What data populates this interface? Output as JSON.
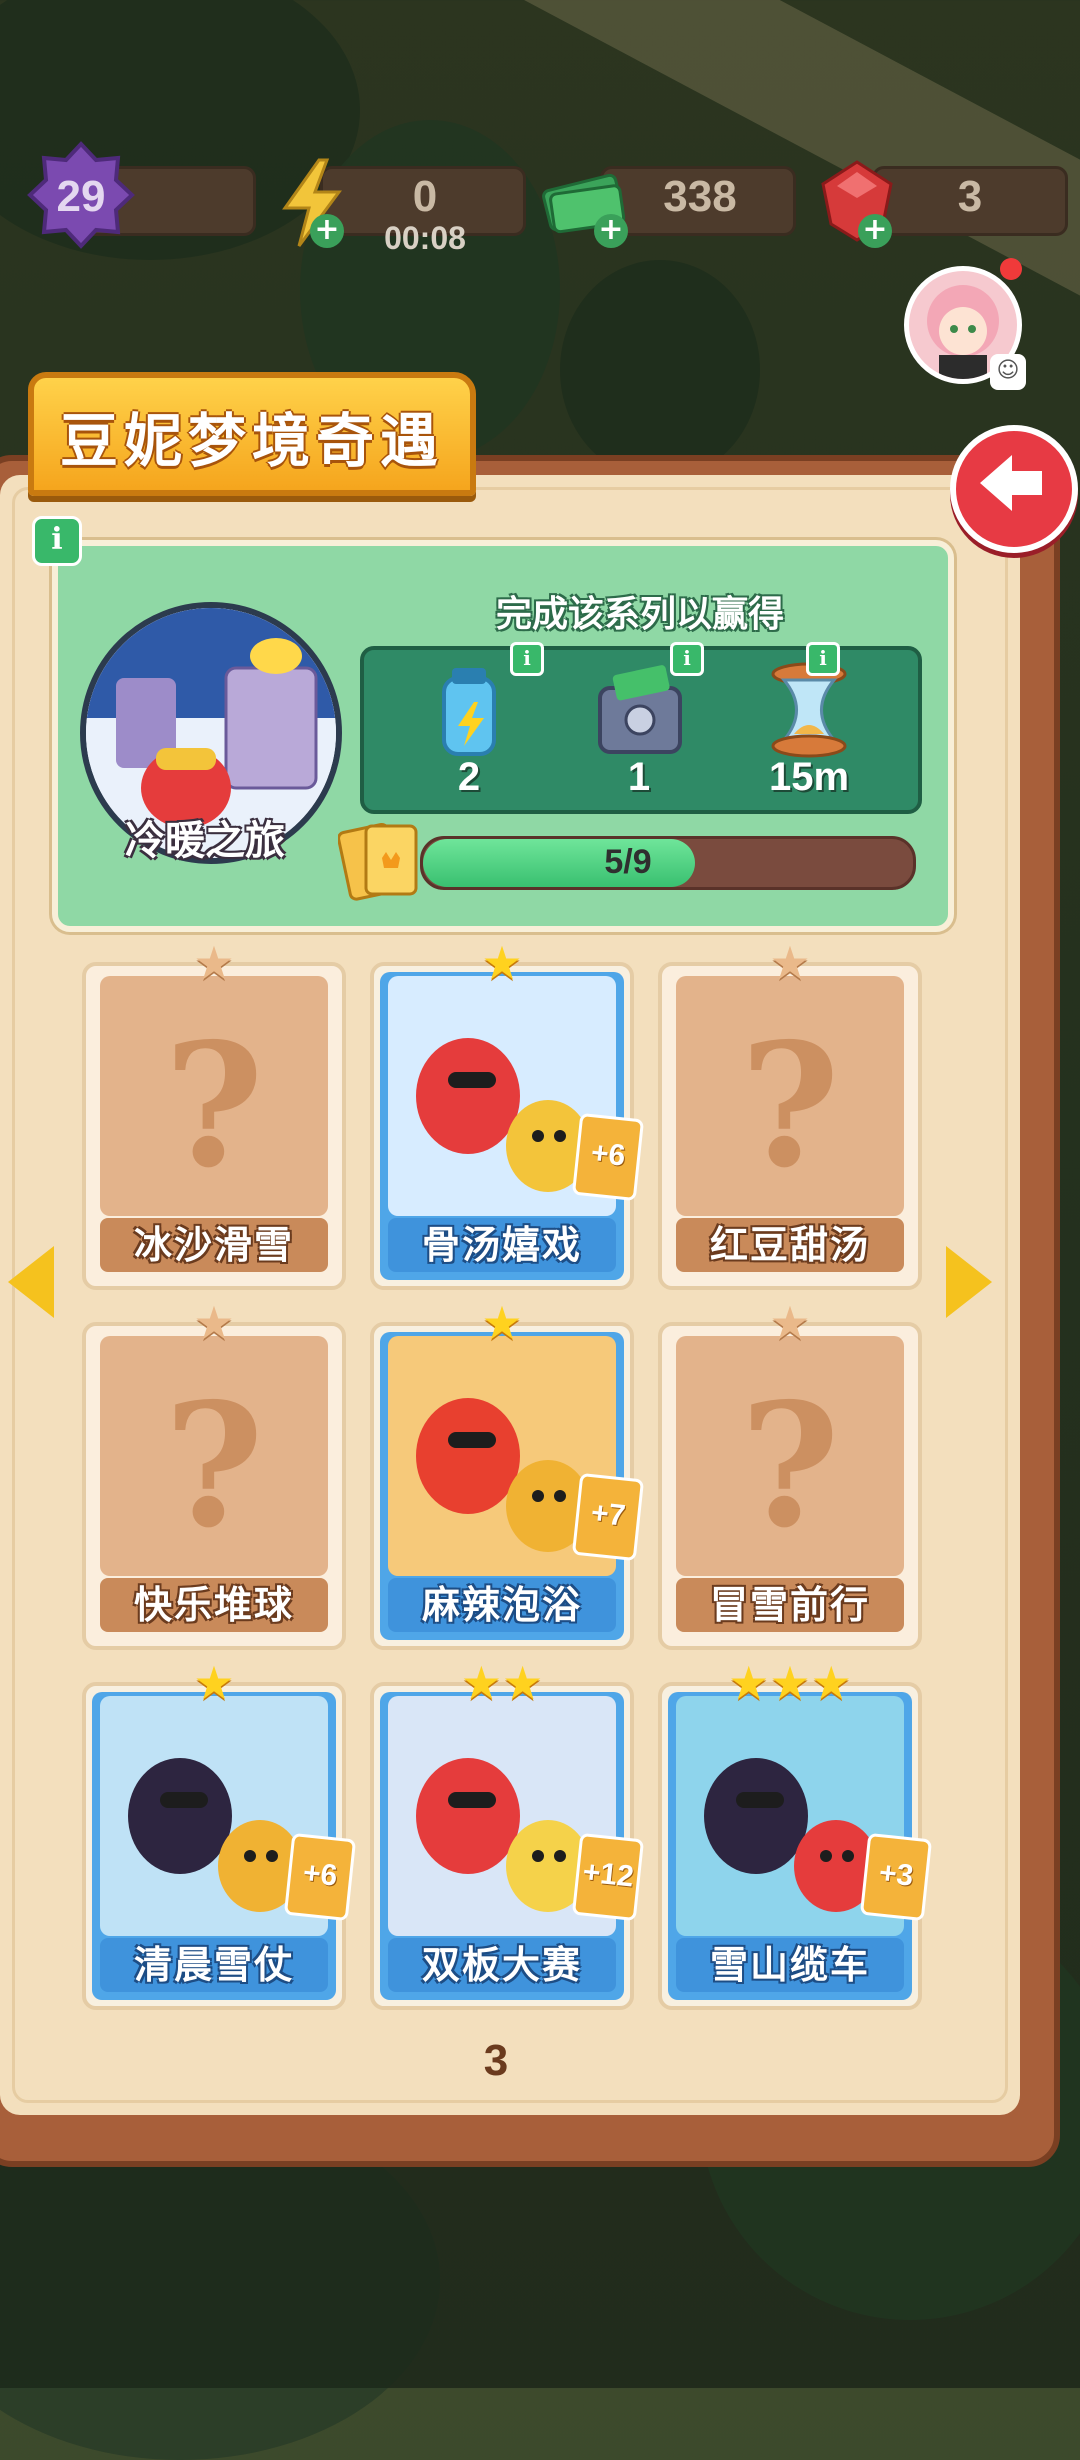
{
  "hud": {
    "level": "29",
    "energy": "0",
    "energy_timer": "00:08",
    "cash": "338",
    "gems": "3"
  },
  "panel": {
    "title": "豆妮梦境奇遇",
    "series_name": "冷暖之旅",
    "reward_title": "完成该系列以赢得",
    "rewards": [
      {
        "icon": "energy-drink-icon",
        "count": "2"
      },
      {
        "icon": "cash-safe-icon",
        "count": "1"
      },
      {
        "icon": "hourglass-icon",
        "count": "15m"
      }
    ],
    "progress_text": "5/9",
    "progress_value": 0.556,
    "page_number": "3"
  },
  "cards": [
    {
      "label": "冰沙滑雪",
      "unlocked": false,
      "stars": 1
    },
    {
      "label": "骨汤嬉戏",
      "unlocked": true,
      "stars": 1,
      "bonus": "+6"
    },
    {
      "label": "红豆甜汤",
      "unlocked": false,
      "stars": 1
    },
    {
      "label": "快乐堆球",
      "unlocked": false,
      "stars": 1
    },
    {
      "label": "麻辣泡浴",
      "unlocked": true,
      "stars": 1,
      "bonus": "+7"
    },
    {
      "label": "冒雪前行",
      "unlocked": false,
      "stars": 1
    },
    {
      "label": "清晨雪仗",
      "unlocked": true,
      "stars": 1,
      "bonus": "+6"
    },
    {
      "label": "双板大赛",
      "unlocked": true,
      "stars": 2,
      "bonus": "+12"
    },
    {
      "label": "雪山缆车",
      "unlocked": true,
      "stars": 3,
      "bonus": "+3"
    }
  ],
  "colors": {
    "accent": "#f5a51d",
    "panel_brown": "#a85f3a",
    "card_blue": "#3f93dc",
    "reward_green": "#8fd8a5",
    "close_red": "#e73a44"
  }
}
